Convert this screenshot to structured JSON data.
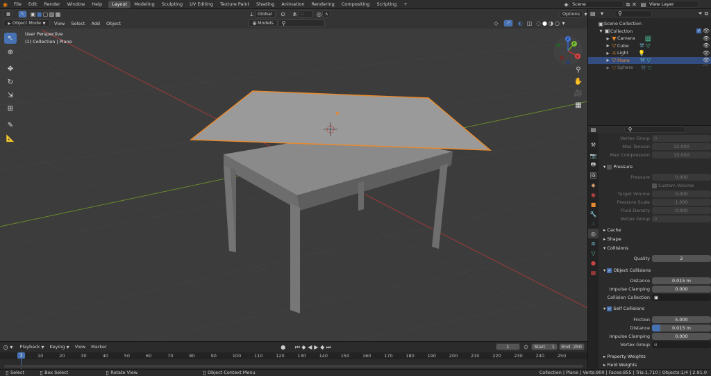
{
  "topbar": {
    "menu": [
      "File",
      "Edit",
      "Render",
      "Window",
      "Help"
    ],
    "workspaces": [
      "Layout",
      "Modeling",
      "Sculpting",
      "UV Editing",
      "Texture Paint",
      "Shading",
      "Animation",
      "Rendering",
      "Compositing",
      "Scripting"
    ],
    "active_workspace": "Layout",
    "add_tab": "+",
    "scene": "Scene",
    "view_layer": "View Layer"
  },
  "viewport": {
    "mode": "Object Mode",
    "menus": [
      "View",
      "Select",
      "Add",
      "Object"
    ],
    "orientation": "Global",
    "snap_target": "Models",
    "options": "Options",
    "overlay_title": "User Perspective",
    "overlay_subtitle": "(1) Collection | Plane",
    "gizmo_axes": {
      "x": "X",
      "y": "Y",
      "z": "Z"
    }
  },
  "outliner": {
    "root": "Scene Collection",
    "collection": "Collection",
    "items": [
      {
        "label": "Camera",
        "selected": false
      },
      {
        "label": "Cube",
        "selected": false
      },
      {
        "label": "Light",
        "selected": false
      },
      {
        "label": "Plane",
        "selected": true
      },
      {
        "label": "Sphere",
        "selected": false
      }
    ]
  },
  "properties": {
    "rows": [
      {
        "label": "Vertex Group",
        "value": "",
        "kind": "group"
      },
      {
        "label": "Max Tension",
        "value": "15.000",
        "kind": "dim"
      },
      {
        "label": "Max Compression",
        "value": "15.000",
        "kind": "dim"
      }
    ],
    "pressure": {
      "title": "Pressure",
      "pressure": {
        "label": "Pressure",
        "value": "0.000"
      },
      "custom_volume": "Custom Volume",
      "target_volume": {
        "label": "Target Volume",
        "value": "0.000"
      },
      "pressure_scale": {
        "label": "Pressure Scale",
        "value": "1.000"
      },
      "fluid_density": {
        "label": "Fluid Density",
        "value": "0.000"
      },
      "vertex_group": "Vertex Group"
    },
    "panels": [
      "Cache",
      "Shape",
      "Collisions"
    ],
    "quality": {
      "label": "Quality",
      "value": "2"
    },
    "object_collisions": {
      "title": "Object Collisions",
      "distance": {
        "label": "Distance",
        "value": "0.015 m"
      },
      "impulse": {
        "label": "Impulse Clamping",
        "value": "0.000"
      },
      "collection": {
        "label": "Collision Collection"
      }
    },
    "self_collisions": {
      "title": "Self Collisions",
      "friction": {
        "label": "Friction",
        "value": "5.000"
      },
      "distance": {
        "label": "Distance",
        "value": "0.015 m"
      },
      "impulse": {
        "label": "Impulse Clamping",
        "value": "0.000"
      },
      "vertex_group": {
        "label": "Vertex Group"
      }
    },
    "bottom_panels": [
      "Property Weights",
      "Field Weights"
    ]
  },
  "timeline": {
    "menus": [
      "Playback",
      "Keying",
      "View",
      "Marker"
    ],
    "current_frame": "1",
    "start_label": "Start",
    "start": "1",
    "end_label": "End",
    "end": "250",
    "ruler": [
      "1",
      "10",
      "20",
      "30",
      "40",
      "50",
      "60",
      "70",
      "80",
      "90",
      "100",
      "110",
      "120",
      "130",
      "140",
      "150",
      "160",
      "170",
      "180",
      "190",
      "200",
      "210",
      "220",
      "230",
      "240",
      "250"
    ]
  },
  "statusbar": {
    "select": "Select",
    "box_select": "Box Select",
    "rotate_view": "Rotate View",
    "context_menu": "Object Context Menu",
    "stats": "Collection | Plane | Verts:900 | Faces:855 | Tris:1,710 | Objects:1/4 | 2.91.0"
  },
  "colors": {
    "accent": "#4772b3",
    "selection": "#e78a2f",
    "grid_red": "#a03a3a",
    "grid_green": "#6a8a2a"
  }
}
